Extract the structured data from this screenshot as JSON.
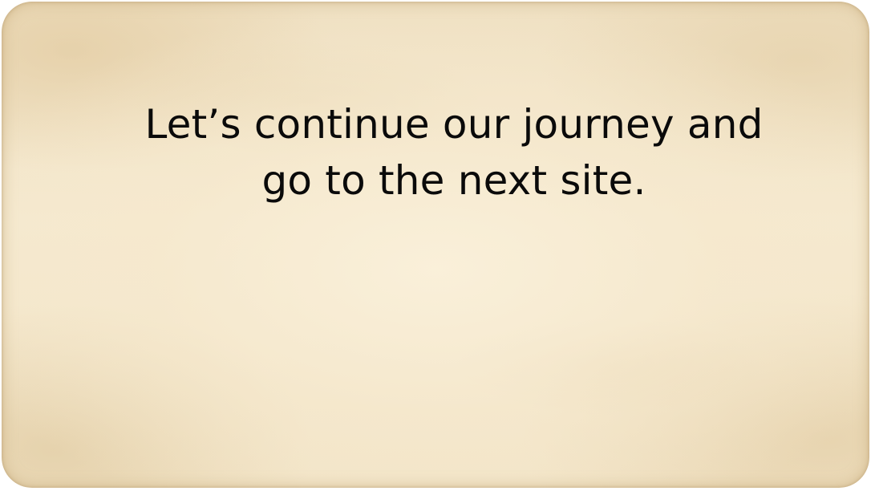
{
  "slide": {
    "message_line_1": "Let’s continue our journey and",
    "message_line_2": "go to the next site."
  },
  "colors": {
    "paper": "#f5e9cf",
    "text": "#0a0a0a"
  }
}
